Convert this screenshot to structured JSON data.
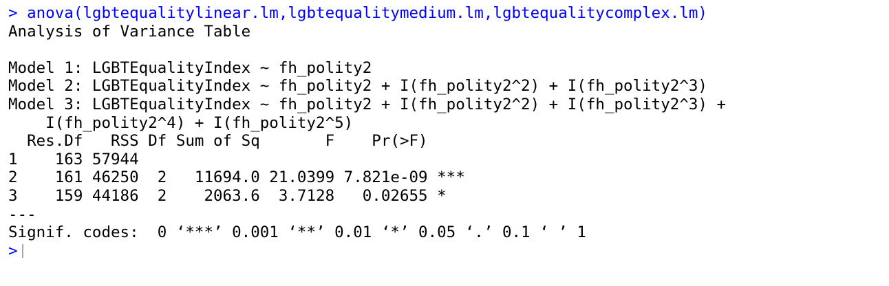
{
  "console": {
    "prompt": "> ",
    "command": "anova(lgbtequalitylinear.lm,lgbtequalitymedium.lm,lgbtequalitycomplex.lm)",
    "heading": "Analysis of Variance Table",
    "models": [
      "Model 1: LGBTEqualityIndex ~ fh_polity2",
      "Model 2: LGBTEqualityIndex ~ fh_polity2 + I(fh_polity2^2) + I(fh_polity2^3)",
      "Model 3: LGBTEqualityIndex ~ fh_polity2 + I(fh_polity2^2) + I(fh_polity2^3) +",
      "    I(fh_polity2^4) + I(fh_polity2^5)"
    ],
    "table_header": "  Res.Df   RSS Df Sum of Sq       F    Pr(>F)",
    "table_rows": [
      "1    163 57944",
      "2    161 46250  2   11694.0 21.0399 7.821e-09 ***",
      "3    159 44186  2    2063.6  3.7128   0.02655 *"
    ],
    "separator": "---",
    "signif_codes": "Signif. codes:  0 ‘***’ 0.001 ‘**’ 0.01 ‘*’ 0.05 ‘.’ 0.1 ‘ ’ 1",
    "next_prompt": ">"
  }
}
